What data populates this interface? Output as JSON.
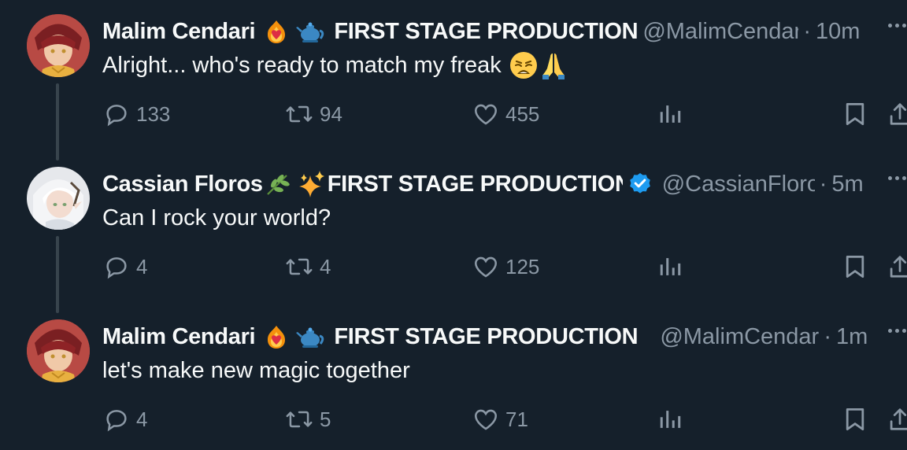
{
  "colors": {
    "background": "#15202b",
    "text": "#f7f9f9",
    "muted": "#8b98a5",
    "thread_line": "#38444d",
    "verified": "#1d9bf0"
  },
  "tweets": [
    {
      "name": "Malim Cendari",
      "name_emojis": [
        "fire-heart-emoji",
        "teapot-emoji"
      ],
      "affiliation": "FIRST STAGE PRODUCTION",
      "verified": false,
      "handle": "@MalimCendari",
      "separator": "·",
      "time": "10m",
      "text": "Alright... who's ready to match my freak",
      "text_emojis": [
        "weary-face-emoji",
        "folded-hands-emoji"
      ],
      "replies": "133",
      "reposts": "94",
      "likes": "455"
    },
    {
      "name": "Cassian Floros",
      "name_emojis": [
        "herb-emoji",
        "sparkles-emoji"
      ],
      "affiliation": "FIRST STAGE PRODUCTION",
      "verified": true,
      "handle": "@CassianFloros",
      "separator": "·",
      "time": "5m",
      "text": "Can I rock your world?",
      "text_emojis": [],
      "replies": "4",
      "reposts": "4",
      "likes": "125"
    },
    {
      "name": "Malim Cendari",
      "name_emojis": [
        "fire-heart-emoji",
        "teapot-emoji"
      ],
      "affiliation": "FIRST STAGE PRODUCTION",
      "verified": false,
      "handle": "@MalimCendari",
      "separator": "·",
      "time": "1m",
      "text": "let's make new magic together",
      "text_emojis": [],
      "replies": "4",
      "reposts": "5",
      "likes": "71"
    }
  ]
}
